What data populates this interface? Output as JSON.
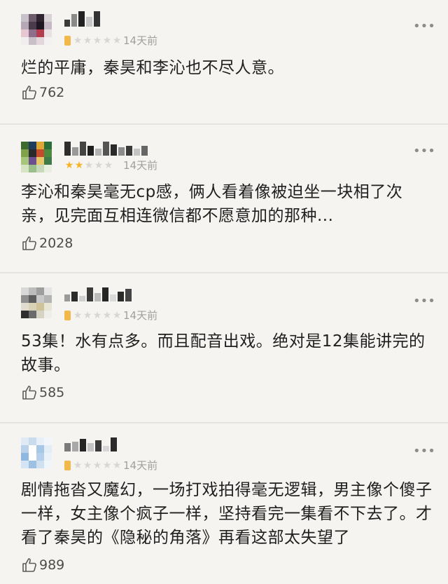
{
  "colors": {
    "background": "#f6f4f0",
    "text": "#1f1f1f",
    "meta": "#a2a09c",
    "star_on": "#f5b325",
    "star_off": "#d8d6d2",
    "divider": "#e6e3de"
  },
  "icons": {
    "like": "thumbs-up-icon",
    "more": "more-dots-icon",
    "star": "star-icon"
  },
  "reviews": [
    {
      "time": "14天前",
      "rating": 0,
      "text_lines": [
        "烂的平庸，秦昊和李沁也不尽人意。"
      ],
      "likes": "762"
    },
    {
      "time": "14天前",
      "rating": 2,
      "text_lines": [
        "李沁和秦昊毫无cp感，俩人看着像被迫坐一块相了次",
        "亲，见完面互相连微信都不愿意加的那种..."
      ],
      "likes": "2028"
    },
    {
      "time": "14天前",
      "rating": 0,
      "text_lines": [
        "53集！水有点多。而且配音出戏。绝对是12集能讲完的",
        "故事。"
      ],
      "likes": "585"
    },
    {
      "time": "14天前",
      "rating": 0,
      "text_lines": [
        "剧情拖沓又魔幻，一场打戏拍得毫无逻辑，男主像个傻子",
        "一样，女主像个疯子一样，坚持看完一集看不下去了。才",
        "看了秦昊的《隐秘的角落》再看这部太失望了"
      ],
      "likes": "989"
    }
  ]
}
